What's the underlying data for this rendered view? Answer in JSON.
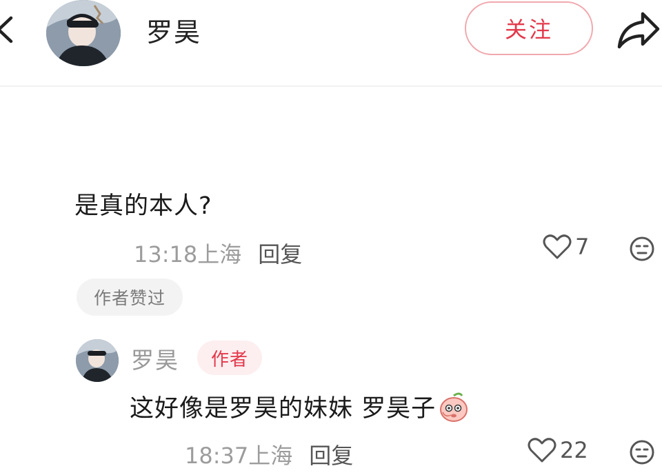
{
  "header": {
    "username": "罗昊",
    "follow_label": "关注"
  },
  "comment": {
    "text": "是真的本人?",
    "time": "13:18",
    "location": "上海",
    "reply_label": "回复",
    "likes": "7",
    "author_liked_badge": "作者赞过"
  },
  "reply": {
    "username": "罗昊",
    "author_badge": "作者",
    "text": "这好像是罗昊的妹妹 罗昊子",
    "time": "18:37",
    "location": "上海",
    "reply_label": "回复",
    "likes": "22"
  },
  "icons": {
    "back": "chevron-left-icon",
    "share": "share-arrow-icon",
    "like": "heart-outline-icon",
    "emoji": "emoji-face-icon",
    "reply_emoji": "peach-face-emoji"
  },
  "colors": {
    "accent": "#e3384a",
    "follow_border": "#f0a8ae",
    "muted_text": "#9c9c9c",
    "badge_bg": "#f3f3f3",
    "author_badge_bg": "#fdeef0"
  }
}
